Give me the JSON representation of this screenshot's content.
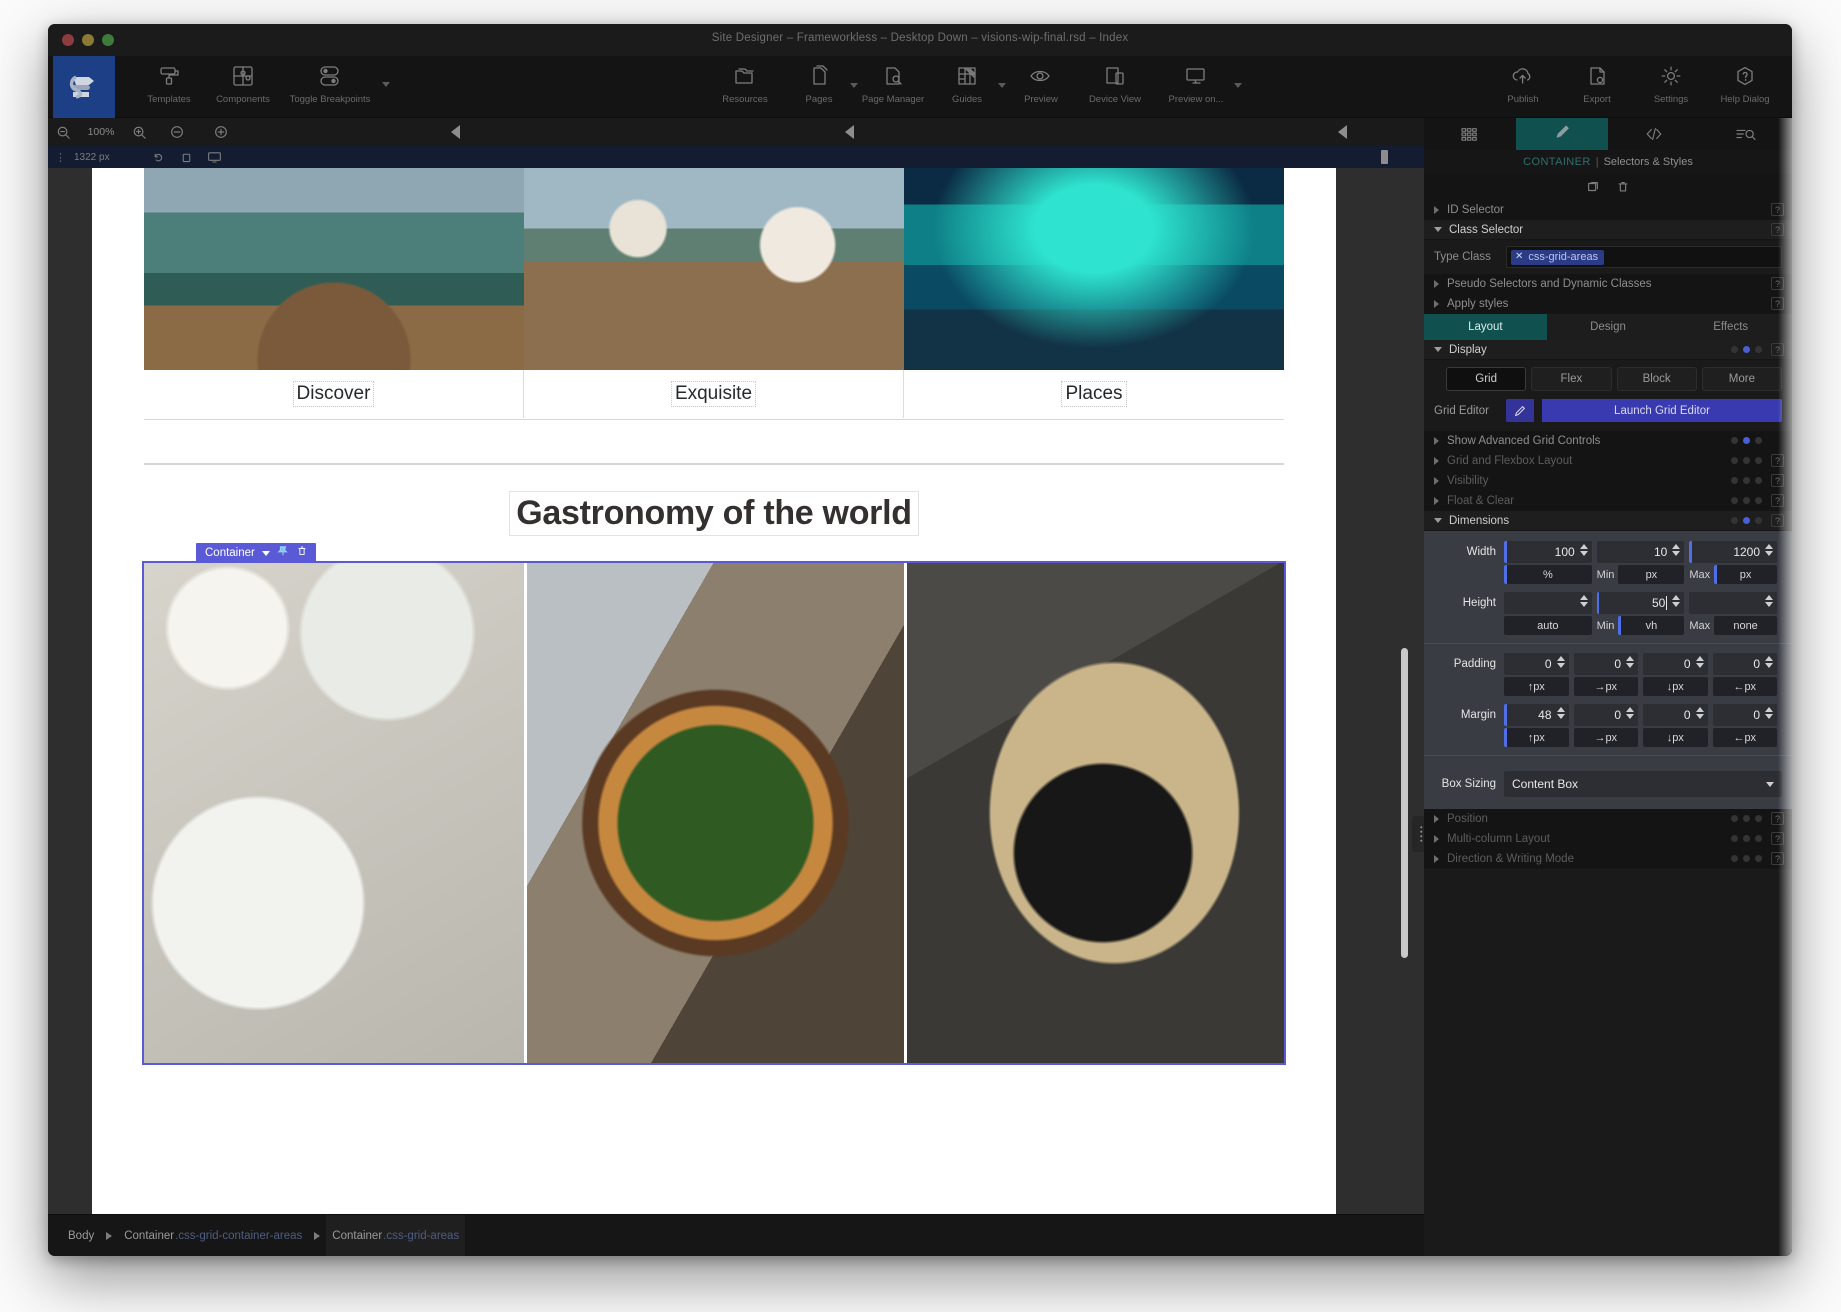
{
  "window": {
    "title": "Site Designer – Frameworkless – Desktop Down – visions-wip-final.rsd – Index"
  },
  "toolbar": {
    "left_items": [
      {
        "label": "Templates",
        "icon": "paint-roller-icon"
      },
      {
        "label": "Components",
        "icon": "components-grid-icon"
      },
      {
        "label": "Toggle Breakpoints",
        "icon": "toggle-switches-icon"
      }
    ],
    "center_items": [
      {
        "label": "Resources",
        "icon": "folders-icon"
      },
      {
        "label": "Pages",
        "icon": "pages-icon"
      },
      {
        "label": "Page Manager",
        "icon": "page-manager-icon"
      },
      {
        "label": "Guides",
        "icon": "guides-icon"
      },
      {
        "label": "Preview",
        "icon": "eye-icon"
      },
      {
        "label": "Device View",
        "icon": "device-view-icon"
      },
      {
        "label": "Preview on...",
        "icon": "monitor-icon"
      }
    ],
    "right_items": [
      {
        "label": "Publish",
        "icon": "cloud-upload-icon"
      },
      {
        "label": "Export",
        "icon": "export-file-icon"
      },
      {
        "label": "Settings",
        "icon": "gear-icon"
      },
      {
        "label": "Help Dialog",
        "icon": "help-hexagon-icon"
      }
    ]
  },
  "zoom_bar": {
    "zoom_level": "100%",
    "zoom_out_icon": "zoom-out-magnifier-icon",
    "zoom_in_icon": "zoom-in-magnifier-icon",
    "minus_icon": "minus-circle-icon",
    "plus_icon": "plus-circle-icon"
  },
  "breakpoint_bar": {
    "grip": "⋮",
    "width_value": "1322 px",
    "icons": [
      "undo-icon",
      "copy-icon",
      "monitor-icon"
    ]
  },
  "canvas": {
    "top_row": [
      {
        "caption": "Discover",
        "image": "lake-boat-mountains"
      },
      {
        "caption": "Exquisite",
        "image": "resort-deck-umbrella"
      },
      {
        "caption": "Places",
        "image": "aurora-ice-lagoon"
      }
    ],
    "section_title": "Gastronomy of the world",
    "food_row": [
      {
        "image": "salad-bowls-table"
      },
      {
        "image": "spinach-ricotta-pizza"
      },
      {
        "image": "ramen-noodle-bowl"
      }
    ],
    "selection_badge": {
      "label": "Container",
      "caret_icon": "chevron-down-icon",
      "pin_icon": "pin-icon",
      "delete_icon": "trash-icon"
    }
  },
  "breadcrumb": {
    "items": [
      {
        "tag": "Body",
        "cls": "",
        "active": false
      },
      {
        "tag": "Container",
        "cls": ".css-grid-container-areas",
        "active": false
      },
      {
        "tag": "Container",
        "cls": ".css-grid-areas",
        "active": true
      }
    ]
  },
  "inspector": {
    "tabs": [
      {
        "icon": "grid-panel-icon",
        "active": false
      },
      {
        "icon": "paintbrush-icon",
        "active": true
      },
      {
        "icon": "code-angle-brackets-icon",
        "active": false
      },
      {
        "icon": "filter-search-icon",
        "active": false
      }
    ],
    "header": {
      "object": "CONTAINER",
      "separator": "|",
      "subtitle": "Selectors & Styles"
    },
    "actions": [
      {
        "icon": "duplicate-icon"
      },
      {
        "icon": "trash-icon"
      }
    ],
    "selector_rows": [
      {
        "label": "ID Selector",
        "open": false,
        "help": "?"
      },
      {
        "label": "Class Selector",
        "open": true,
        "help": "?"
      }
    ],
    "type_class": {
      "label": "Type Class",
      "chip": "css-grid-areas",
      "chip_close": "✕"
    },
    "after_rows": [
      {
        "label": "Pseudo Selectors and Dynamic Classes",
        "help": "?"
      },
      {
        "label": "Apply styles",
        "help": "?"
      }
    ],
    "lde_tabs": [
      {
        "label": "Layout",
        "active": true
      },
      {
        "label": "Design",
        "active": false
      },
      {
        "label": "Effects",
        "active": false
      }
    ],
    "display": {
      "label": "Display",
      "help": "?",
      "dots": [
        false,
        true,
        false
      ],
      "buttons": [
        {
          "label": "Grid",
          "active": true
        },
        {
          "label": "Flex",
          "active": false
        },
        {
          "label": "Block",
          "active": false
        },
        {
          "label": "More",
          "active": false
        }
      ]
    },
    "grid_editor": {
      "label": "Grid Editor",
      "button": "Launch Grid Editor",
      "pen_icon": "pencil-icon"
    },
    "collapsed_rows": [
      {
        "label": "Show Advanced Grid Controls",
        "dots": [
          false,
          true,
          false
        ],
        "help": ""
      },
      {
        "label": "Grid and Flexbox Layout",
        "dots": [
          false,
          false,
          false
        ],
        "help": "?"
      },
      {
        "label": "Visibility",
        "dots": [
          false,
          false,
          false
        ],
        "help": "?"
      },
      {
        "label": "Float & Clear",
        "dots": [
          false,
          false,
          false
        ],
        "help": "?"
      }
    ],
    "dimensions": {
      "title": "Dimensions",
      "help": "?",
      "dots": [
        false,
        true,
        false
      ],
      "width": {
        "label": "Width",
        "values": [
          "100",
          "10",
          "1200"
        ],
        "units": [
          "%",
          "px",
          "px"
        ],
        "unit_labels": [
          "",
          "Min",
          "Max"
        ],
        "active_bars": [
          true,
          false,
          true
        ]
      },
      "height": {
        "label": "Height",
        "values": [
          "",
          "50",
          ""
        ],
        "units": [
          "auto",
          "vh",
          "none"
        ],
        "unit_labels": [
          "",
          "Min",
          "Max"
        ],
        "active_bars": [
          false,
          true,
          false
        ]
      },
      "padding": {
        "label": "Padding",
        "values": [
          "0",
          "0",
          "0",
          "0"
        ],
        "units": [
          "↑px",
          "→px",
          "↓px",
          "←px"
        ]
      },
      "margin": {
        "label": "Margin",
        "values": [
          "48",
          "0",
          "0",
          "0"
        ],
        "units": [
          "↑px",
          "→px",
          "↓px",
          "←px"
        ]
      },
      "box_sizing": {
        "label": "Box Sizing",
        "value": "Content Box"
      }
    },
    "bottom_rows": [
      {
        "label": "Position",
        "dots": [
          false,
          false,
          false
        ],
        "help": "?"
      },
      {
        "label": "Multi-column Layout",
        "dots": [
          false,
          false,
          false
        ],
        "help": "?"
      },
      {
        "label": "Direction & Writing Mode",
        "dots": [
          false,
          false,
          false
        ],
        "help": "?"
      }
    ]
  },
  "colors": {
    "accent_teal": "#10514f",
    "accent_blue": "#4f6ee8",
    "selection_purple": "#5a5ad6",
    "grid_editor_blue": "#3a3ab0",
    "panel_dark": "#1a1a1a",
    "dims_panel": "#3a3c44"
  }
}
